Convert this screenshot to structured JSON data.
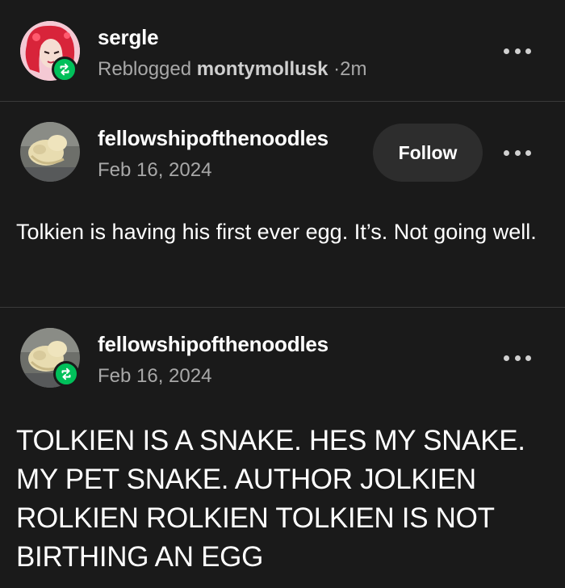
{
  "reblog_header": {
    "username": "sergle",
    "reblogged_label": "Reblogged",
    "source_user": "montymollusk",
    "separator": "·",
    "time": "2m",
    "badge_icon": "reblog-icon",
    "more_icon": "more-options-icon"
  },
  "post1": {
    "username": "fellowshipofthenoodles",
    "date": "Feb 16, 2024",
    "follow_label": "Follow",
    "body": "Tolkien is having his first ever egg. It’s. Not going well.",
    "more_icon": "more-options-icon"
  },
  "post2": {
    "username": "fellowshipofthenoodles",
    "date": "Feb 16, 2024",
    "badge_icon": "reblog-icon",
    "body": "TOLKIEN IS A SNAKE. HES MY SNAKE. MY PET SNAKE. AUTHOR JOLKIEN ROLKIEN ROLKIEN TOLKIEN IS NOT BIRTHING AN EGG",
    "more_icon": "more-options-icon"
  },
  "colors": {
    "background": "#1a1a1a",
    "reblog_green": "#00c05a",
    "muted_text": "#a8a8a8",
    "button_bg": "#2d2d2d",
    "divider": "#3a3a3a"
  }
}
